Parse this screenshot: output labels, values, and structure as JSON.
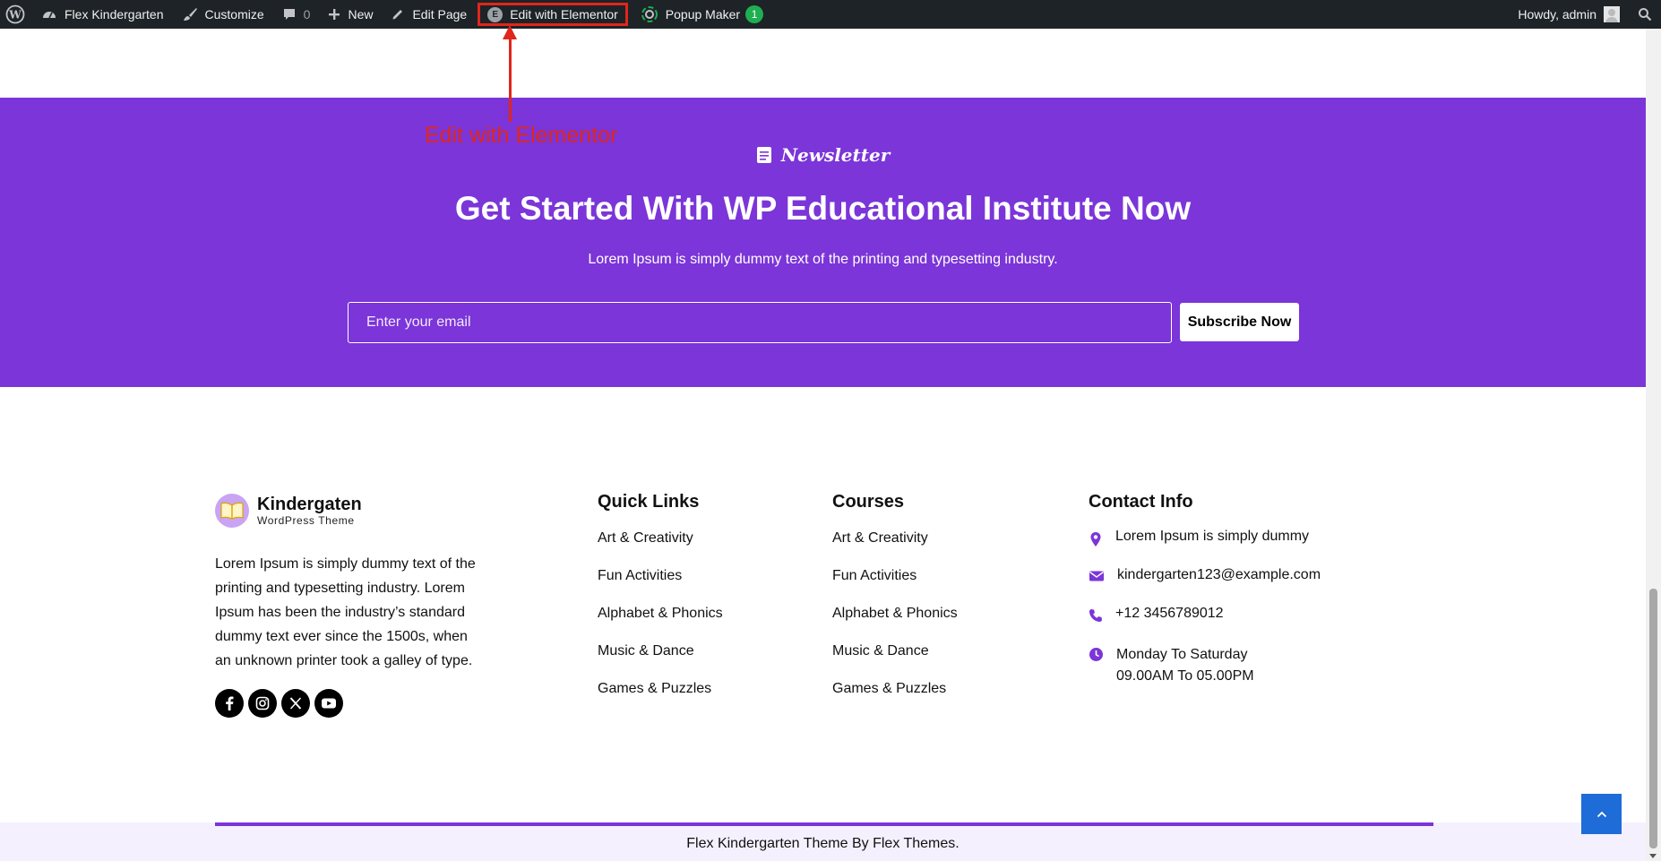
{
  "adminbar": {
    "site_name": "Flex Kindergarten",
    "customize": "Customize",
    "comments_count": "0",
    "new": "New",
    "edit_page": "Edit Page",
    "edit_elementor": "Edit with Elementor",
    "elementor_badge": "E",
    "popup_maker": "Popup Maker",
    "popup_count": "1",
    "howdy": "Howdy, admin"
  },
  "annotation": {
    "label": "Edit with Elementor",
    "color": "#e1261c"
  },
  "newsletter": {
    "tag": "Newsletter",
    "title": "Get Started With WP Educational Institute Now",
    "description": "Lorem Ipsum is simply dummy text of the printing and typesetting industry.",
    "email_placeholder": "Enter your email",
    "email_value": "",
    "button": "Subscribe Now",
    "bg_color": "#7b35d8"
  },
  "footer": {
    "brand_name": "Kindergaten",
    "brand_sub": "WordPress Theme",
    "about": "Lorem Ipsum is simply dummy text of the printing and typesetting industry. Lorem Ipsum has been the industry’s standard dummy text ever since the 1500s, when an unknown printer took a galley of type.",
    "socials": [
      "facebook-icon",
      "instagram-icon",
      "x-twitter-icon",
      "youtube-icon"
    ],
    "quick_links": {
      "title": "Quick Links",
      "items": [
        "Art & Creativity",
        "Fun Activities",
        "Alphabet & Phonics",
        "Music & Dance",
        "Games & Puzzles"
      ]
    },
    "courses": {
      "title": "Courses",
      "items": [
        "Art & Creativity",
        "Fun Activities",
        "Alphabet & Phonics",
        "Music & Dance",
        "Games & Puzzles"
      ]
    },
    "contact": {
      "title": "Contact Info",
      "address": "Lorem Ipsum is simply dummy",
      "email": "kindergarten123@example.com",
      "phone": "+12 3456789012",
      "hours_line1": "Monday To Saturday",
      "hours_line2": "09.00AM To 05.00PM"
    },
    "copyright": "Flex Kindergarten Theme By Flex Themes.",
    "accent_color": "#7b35d8",
    "to_top_color": "#1e6cd8"
  }
}
